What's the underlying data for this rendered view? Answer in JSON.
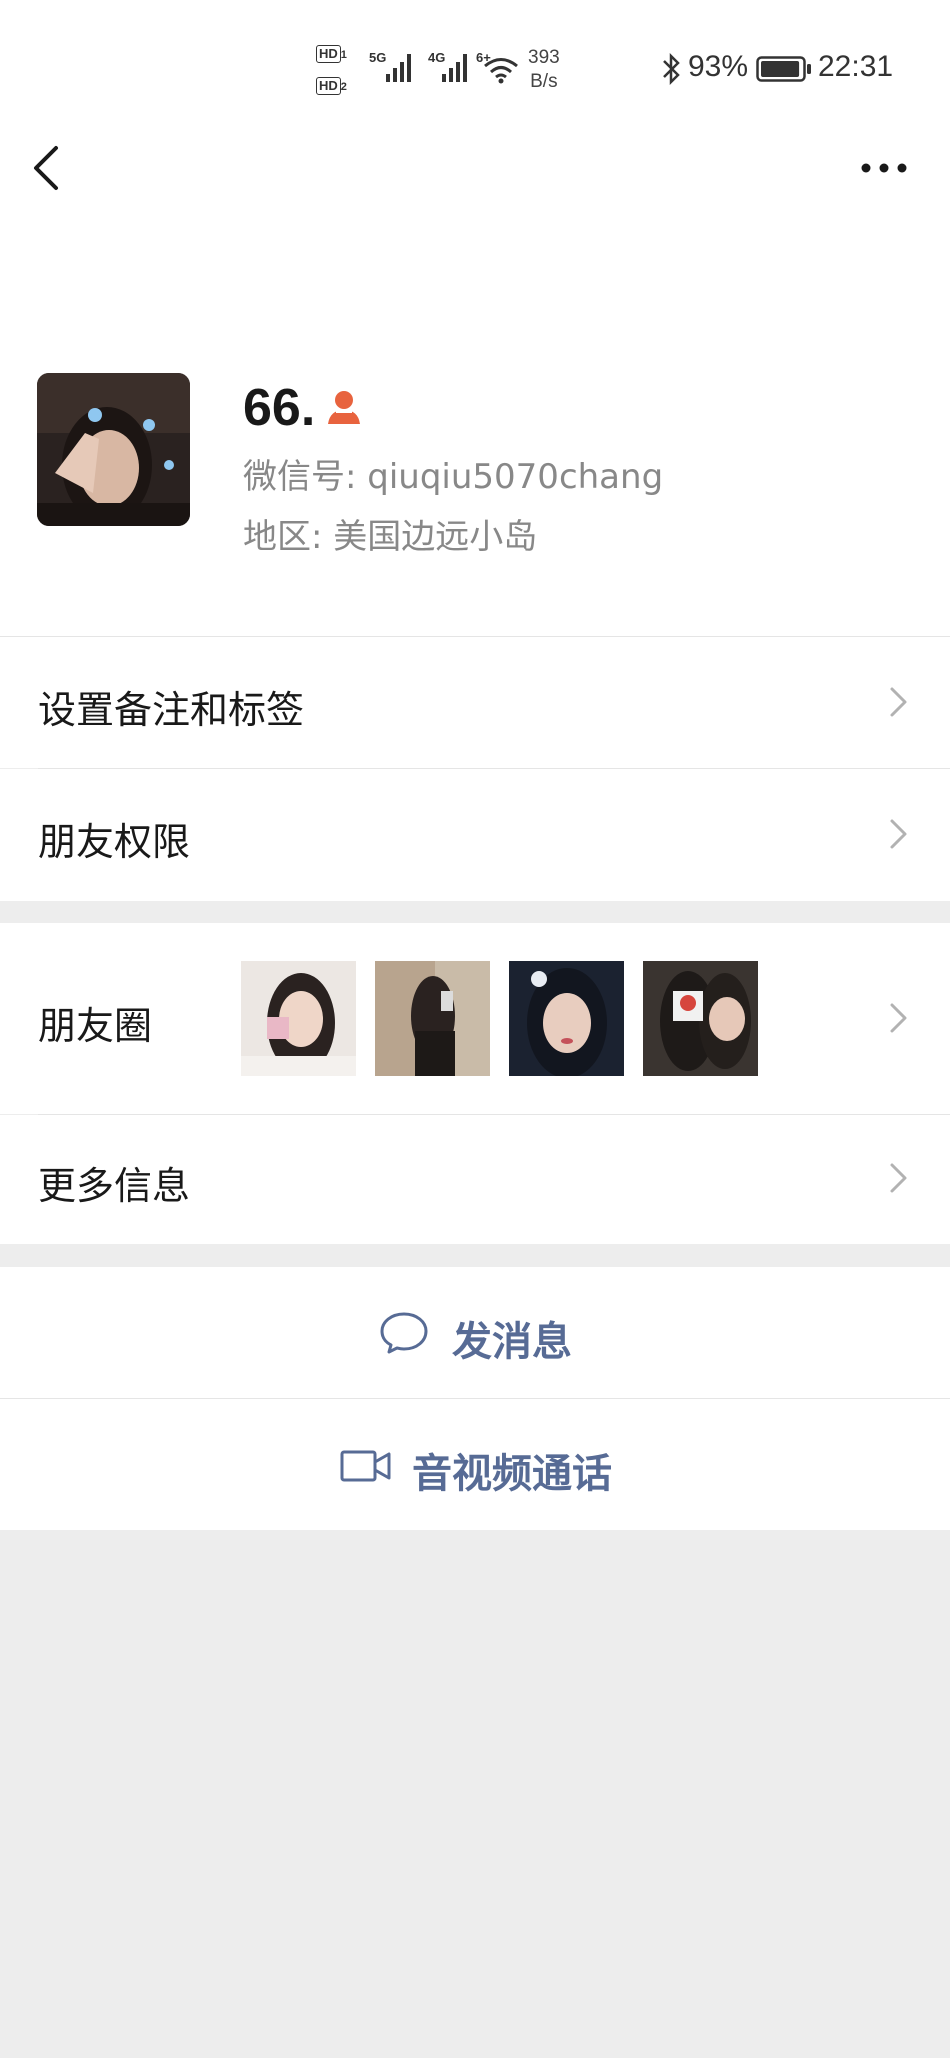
{
  "status_bar": {
    "hd1": "HD",
    "hd1_sub": "1",
    "hd2": "HD",
    "hd2_sub": "2",
    "net1": "5G",
    "net2": "4G",
    "net3": "6+",
    "speed_value": "393",
    "speed_unit": "B/s",
    "battery": "93%",
    "time": "22:31",
    "battery_level": 0.93
  },
  "profile": {
    "nickname": "66.",
    "wechat_id": "微信号: qiuqiu5070chang",
    "region": "地区: 美国边远小岛"
  },
  "menu": {
    "remarks_tags": "设置备注和标签",
    "friend_permissions": "朋友权限",
    "moments": "朋友圈",
    "more_info": "更多信息"
  },
  "actions": {
    "send_message": "发消息",
    "video_call": "音视频通话"
  },
  "colors": {
    "link": "#576b95",
    "gender": "#e8633e",
    "background": "#ededed"
  }
}
